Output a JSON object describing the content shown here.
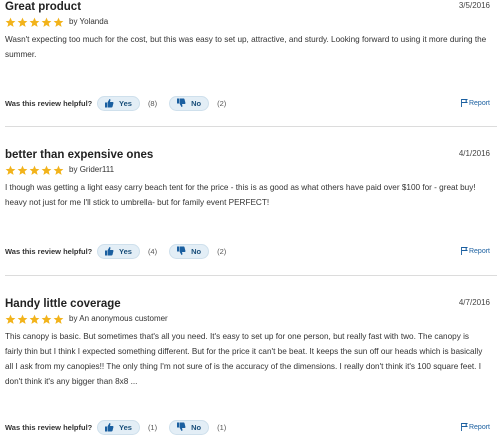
{
  "colors": {
    "star": "#f2b31b",
    "accent": "#1a5fa0",
    "button_bg": "#e3eef6"
  },
  "reviews": [
    {
      "title": "Great product",
      "date": "3/5/2016",
      "rating": 5,
      "by": "by",
      "author": "Yolanda",
      "text": "Wasn't expecting too much for the cost, but this was easy to set up, attractive, and sturdy. Looking forward to using it more during the summer.",
      "helpful_label": "Was this review helpful?",
      "yes_label": "Yes",
      "yes_count": "(8)",
      "no_label": "No",
      "no_count": "(2)",
      "report_label": "Report"
    },
    {
      "title": "better than expensive ones",
      "date": "4/1/2016",
      "rating": 5,
      "by": "by",
      "author": "Grider111",
      "text": "I though was getting a light easy carry beach tent for the price - this is as good as what others have paid over $100 for - great buy! heavy not just for me I'll stick to umbrella- but for family event PERFECT!",
      "helpful_label": "Was this review helpful?",
      "yes_label": "Yes",
      "yes_count": "(4)",
      "no_label": "No",
      "no_count": "(2)",
      "report_label": "Report"
    },
    {
      "title": "Handy little coverage",
      "date": "4/7/2016",
      "rating": 5,
      "by": "by",
      "author": "An anonymous customer",
      "text": "This canopy is basic. But sometimes that's all you need. It's easy to set up for one person, but really fast with two. The canopy is fairly thin but I think I expected something different. But for the price it can't be beat. It keeps the sun off our heads which is basically all I ask from my canopies!! The only thing I'm not sure of is the accuracy of the dimensions. I really don't think it's 100 square feet. I don't think it's any bigger than 8x8 ...",
      "helpful_label": "Was this review helpful?",
      "yes_label": "Yes",
      "yes_count": "(1)",
      "no_label": "No",
      "no_count": "(1)",
      "report_label": "Report"
    }
  ]
}
